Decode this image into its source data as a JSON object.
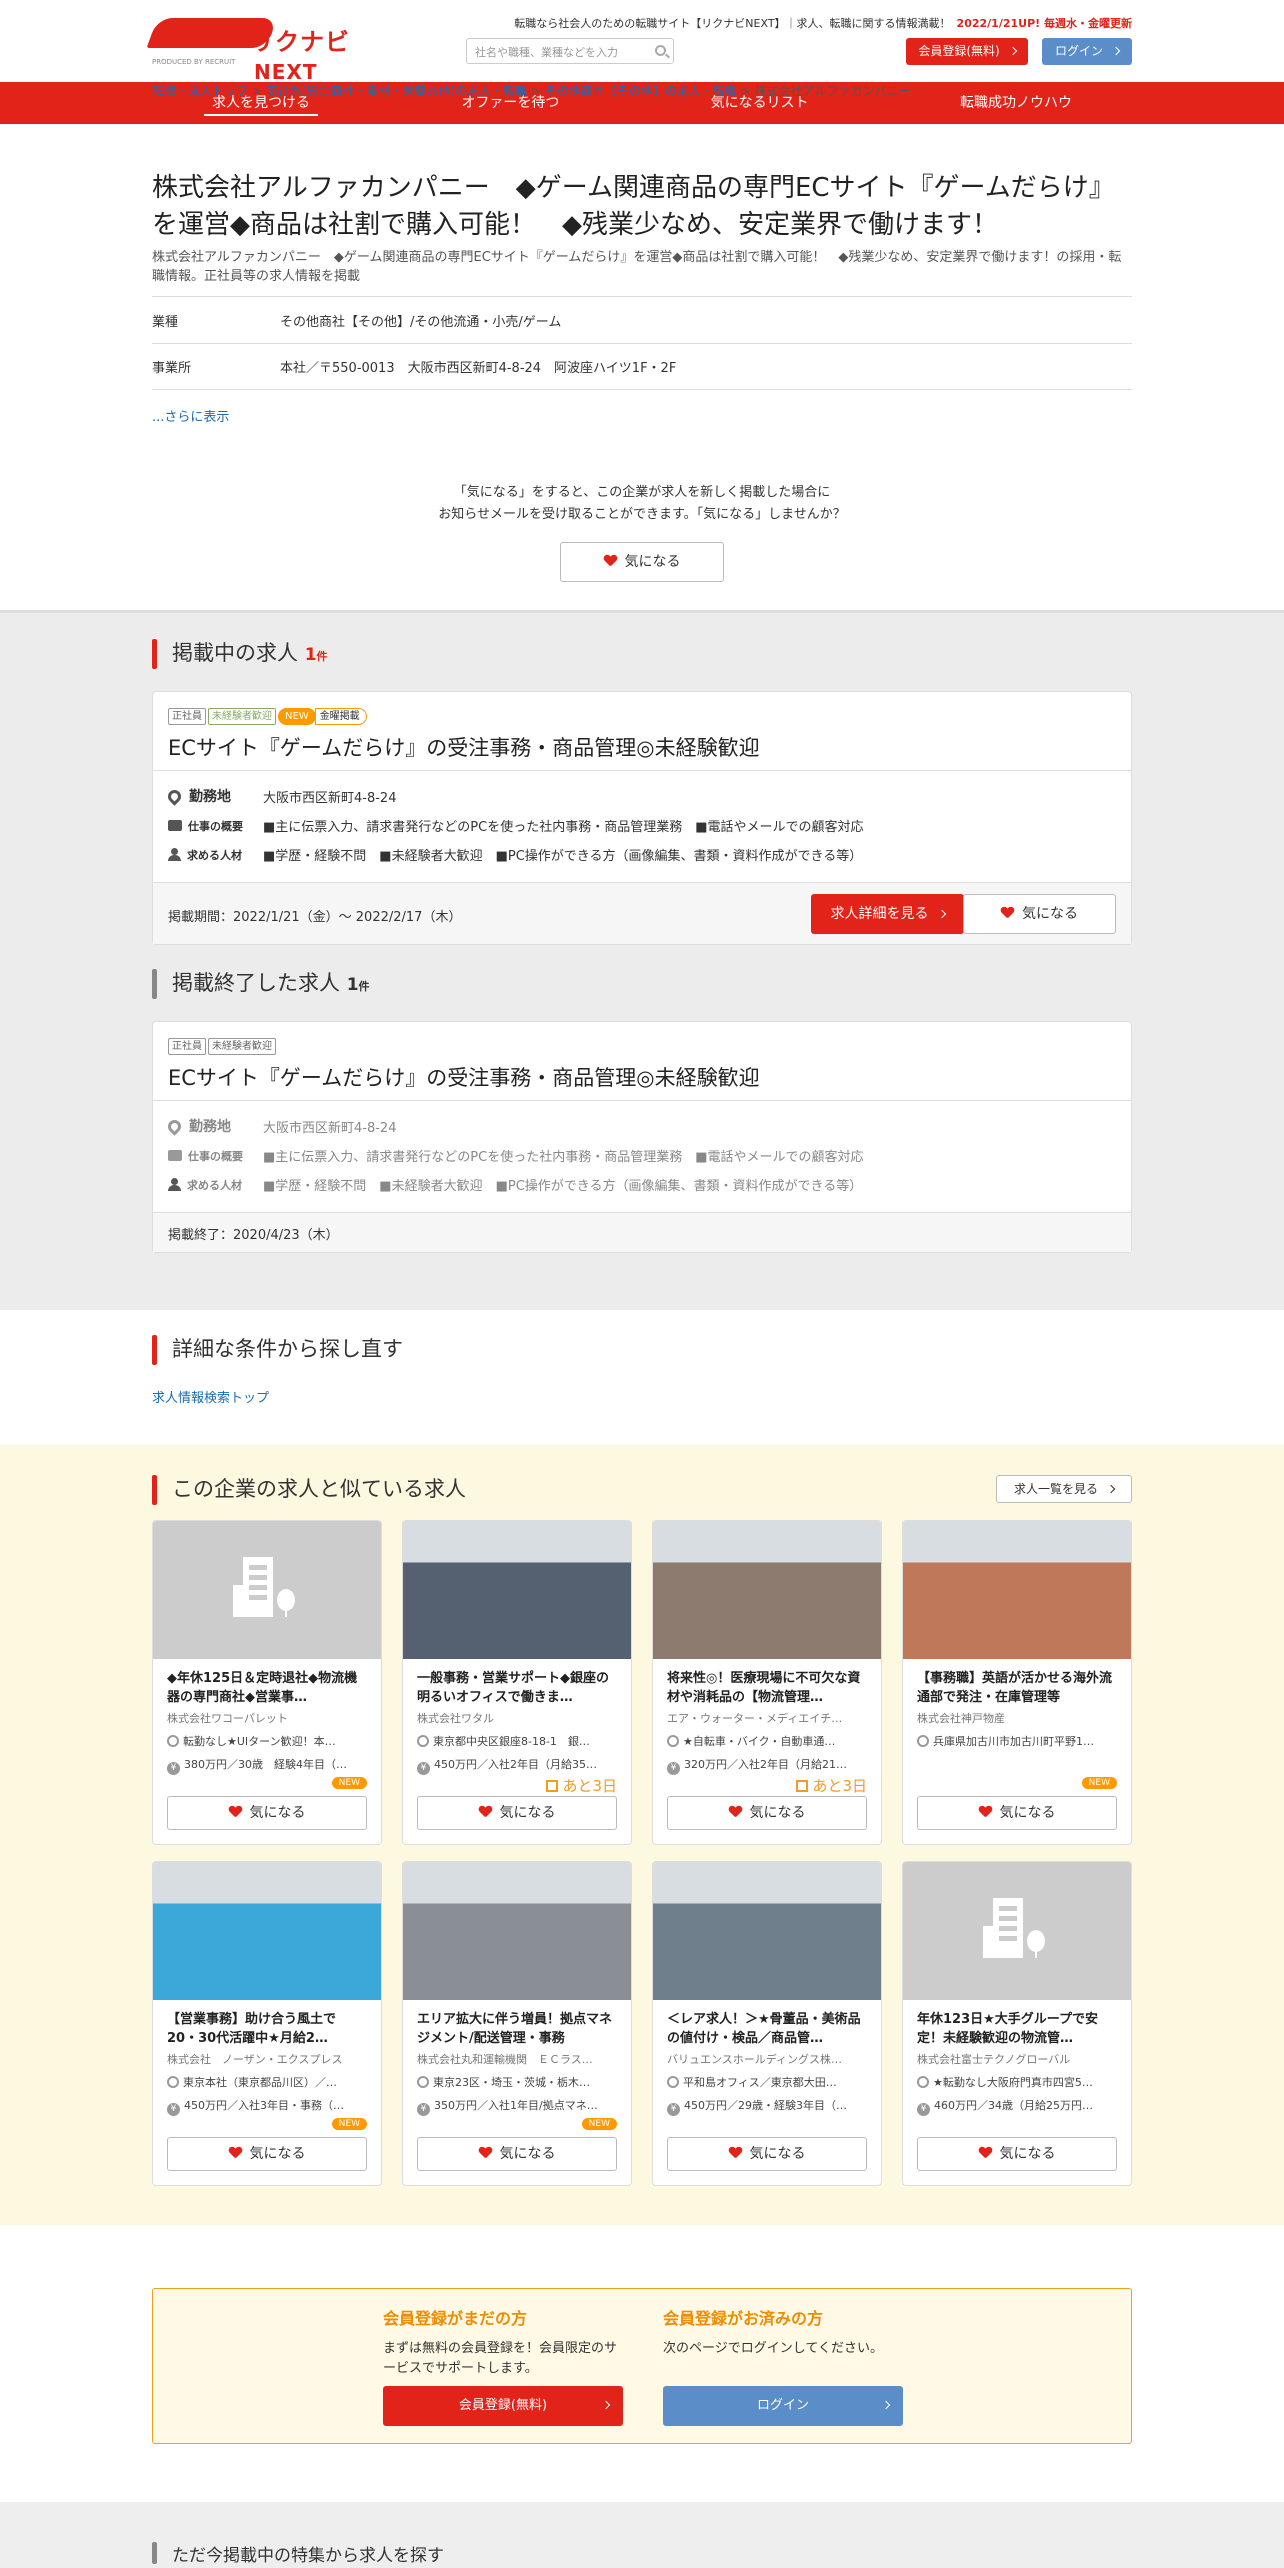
{
  "header": {
    "logo_text": "リクナビ",
    "logo_next": "NEXT",
    "logo_sub": "PRODUCED BY RECRUIT",
    "tagline": "転職なら社会人のための転職サイト【リクナビNEXT】｜求人、転職に関する情報満載！",
    "update_note": "2022/1/21UP! 毎週水・金曜更新",
    "search_placeholder": "社名や職種、業種などを入力",
    "register_label": "会員登録(無料)",
    "login_label": "ログイン"
  },
  "nav": [
    "求人を見つける",
    "オファーを待つ",
    "気になるリスト",
    "転職成功ノウハウ"
  ],
  "breadcrumb": [
    "転職・求人トップ",
    "商社系(総合商社・素材・医薬品他)の求人・転職",
    "その他商社【その他】の求人・転職",
    "株式会社アルファカンパニー"
  ],
  "company": {
    "title": "株式会社アルファカンパニー　◆ゲーム関連商品の専門ECサイト『ゲームだらけ』を運営◆商品は社割で購入可能！　◆残業少なめ、安定業界で働けます！",
    "subtitle": "株式会社アルファカンパニー　◆ゲーム関連商品の専門ECサイト『ゲームだらけ』を運営◆商品は社割で購入可能！　◆残業少なめ、安定業界で働けます！の採用・転職情報。正社員等の求人情報を掲載",
    "rows": [
      {
        "k": "業種",
        "v": "その他商社【その他】/その他流通・小売/ゲーム"
      },
      {
        "k": "事業所",
        "v": "本社／〒550-0013　大阪市西区新町4-8-24　阿波座ハイツ1F・2F"
      }
    ],
    "more": "...さらに表示"
  },
  "kininaru_cta": {
    "line1": "「気になる」をすると、この企業が求人を新しく掲載した場合に",
    "line2": "お知らせメールを受け取ることができます。「気になる」しませんか？",
    "button": "気になる"
  },
  "active_jobs": {
    "heading": "掲載中の求人",
    "count": "1",
    "unit": "件",
    "card": {
      "tags": [
        "正社員",
        "未経験者歓迎",
        "NEW",
        "金曜掲載"
      ],
      "title": "ECサイト『ゲームだらけ』の受注事務・商品管理◎未経験歓迎",
      "location_label": "勤務地",
      "location": "大阪市西区新町4-8-24",
      "work_label": "仕事の概要",
      "work": "■主に伝票入力、請求書発行などのPCを使った社内事務・商品管理業務　■電話やメールでの顧客対応",
      "req_label": "求める人材",
      "req": "■学歴・経験不問　■未経験者大歓迎　■PC操作ができる方（画像編集、書類・資料作成ができる等）",
      "period": "掲載期間：2022/1/21（金）～ 2022/2/17（木）",
      "detail_button": "求人詳細を見る",
      "kini_button": "気になる"
    }
  },
  "ended_jobs": {
    "heading": "掲載終了した求人",
    "count": "1",
    "unit": "件",
    "card": {
      "tags": [
        "正社員",
        "未経験者歓迎"
      ],
      "title": "ECサイト『ゲームだらけ』の受注事務・商品管理◎未経験歓迎",
      "location_label": "勤務地",
      "location": "大阪市西区新町4-8-24",
      "work_label": "仕事の概要",
      "work": "■主に伝票入力、請求書発行などのPCを使った社内事務・商品管理業務　■電話やメールでの顧客対応",
      "req_label": "求める人材",
      "req": "■学歴・経験不問　■未経験者大歓迎　■PC操作ができる方（画像編集、書類・資料作成ができる等）",
      "period": "掲載終了：2020/4/23（木）"
    }
  },
  "search_again": {
    "heading": "詳細な条件から探し直す",
    "link": "求人情報検索トップ"
  },
  "similar": {
    "heading": "この企業の求人と似ている求人",
    "all_button": "求人一覧を見る",
    "kini_label": "気になる",
    "jobs": [
      {
        "title": "◆年休125日＆定時退社◆物流機器の専門商社◆営業事…",
        "company": "株式会社ワコーパレット",
        "l1": "転勤なし★UIターン歓迎！本…",
        "l2": "380万円／30歳　経験4年目（…",
        "badge": "NEW",
        "img": "placeholder"
      },
      {
        "title": "一般事務・営業サポート◆銀座の明るいオフィスで働きま…",
        "company": "株式会社ワタル",
        "l1": "東京都中央区銀座8-18-1　銀…",
        "l2": "450万円／入社2年目（月給35…",
        "badge": "あと3日",
        "img": "photo"
      },
      {
        "title": "将来性◎！医療現場に不可欠な資材や消耗品の【物流管理…",
        "company": "エア・ウォーター・メディエイチ…",
        "l1": "★自転車・バイク・自動車通…",
        "l2": "320万円／入社2年目（月給21…",
        "badge": "あと3日",
        "img": "photo"
      },
      {
        "title": "【事務職】英語が活かせる海外流通部で発注・在庫管理等",
        "company": "株式会社神戸物産",
        "l1": "兵庫県加古川市加古川町平野1…",
        "l2": "",
        "badge": "NEW",
        "img": "photo"
      },
      {
        "title": "【営業事務】助け合う風土で20・30代活躍中★月給2…",
        "company": "株式会社　ノーザン・エクスプレス",
        "l1": "東京本社（東京都品川区）／…",
        "l2": "450万円／入社3年目・事務（…",
        "badge": "NEW",
        "img": "photo"
      },
      {
        "title": "エリア拡大に伴う増員！拠点マネジメント/配送管理・事務",
        "company": "株式会社丸和運輸機関　ＥＣラス…",
        "l1": "東京23区・埼玉・茨城・栃木…",
        "l2": "350万円／入社1年目/拠点マネ…",
        "badge": "NEW",
        "img": "photo"
      },
      {
        "title": "＜レア求人！＞★骨董品・美術品の値付け・検品／商品管…",
        "company": "バリュエンスホールディングス株…",
        "l1": "平和島オフィス／東京都大田…",
        "l2": "450万円／29歳・経験3年目（…",
        "badge": "",
        "img": "photo"
      },
      {
        "title": "年休123日★大手グループで安定！未経験歓迎の物流管…",
        "company": "株式会社富士テクノグローバル",
        "l1": "★転勤なし大阪府門真市四宮5…",
        "l2": "460万円／34歳（月給25万円…",
        "badge": "",
        "img": "placeholder"
      }
    ]
  },
  "member": {
    "left_heading": "会員登録がまだの方",
    "left_text": "まずは無料の会員登録を！会員限定のサービスでサポートします。",
    "left_button": "会員登録(無料)",
    "right_heading": "会員登録がお済みの方",
    "right_text": "次のページでログインしてください。",
    "right_button": "ログイン"
  },
  "bottom": {
    "heading": "ただ今掲載中の特集から求人を探す"
  }
}
